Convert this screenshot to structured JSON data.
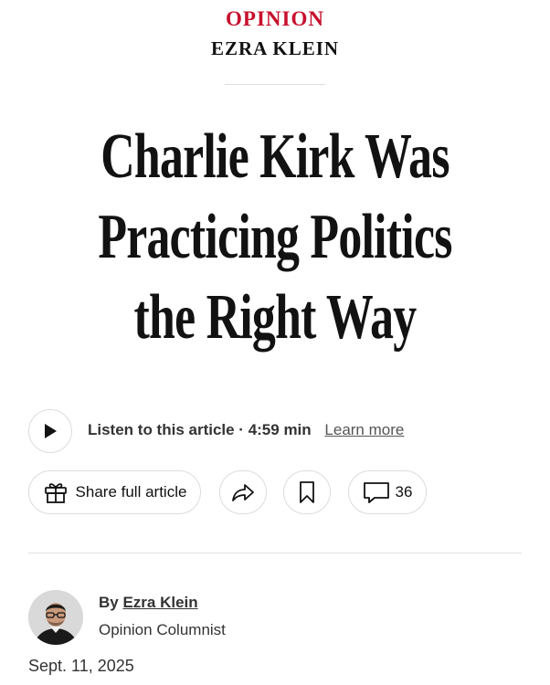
{
  "section": {
    "kicker": "OPINION",
    "columnist": "EZRA KLEIN"
  },
  "headline": {
    "lines": [
      "Charlie Kirk Was",
      "Practicing Politics",
      "the Right Way"
    ]
  },
  "audio": {
    "listen_text": "Listen to this article · 4:59 min",
    "learn_more": "Learn more",
    "play_icon": "play-icon"
  },
  "actions": {
    "share_label": "Share full article",
    "share_icon": "gift-icon",
    "forward_icon": "share-arrow-icon",
    "save_icon": "bookmark-icon",
    "comments_icon": "comment-icon",
    "comment_count": "36"
  },
  "byline": {
    "prefix": "By ",
    "author": "Ezra Klein",
    "role": "Opinion Columnist",
    "date": "Sept. 11, 2025"
  },
  "colors": {
    "kicker": "#c8102e",
    "text": "#121212",
    "border": "#dcdcdc"
  }
}
